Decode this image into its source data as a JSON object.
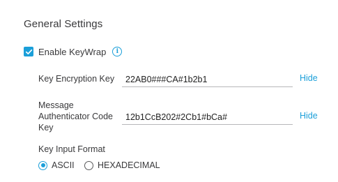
{
  "section": {
    "title": "General Settings"
  },
  "keywrap": {
    "label": "Enable KeyWrap",
    "checked": true,
    "info_icon": "info-icon"
  },
  "fields": {
    "key_encryption": {
      "label": "Key Encryption Key",
      "value": "22AB0###CA#1b2b1",
      "hide_label": "Hide"
    },
    "mac_key": {
      "label_line1": "Message",
      "label_line2": "Authenticator Code",
      "label_line3": "Key",
      "value": "12b1CcB202#2Cb1#bCa#",
      "hide_label": "Hide"
    }
  },
  "input_format": {
    "label": "Key Input Format",
    "options": [
      {
        "label": "ASCII",
        "selected": true
      },
      {
        "label": "HEXADECIMAL",
        "selected": false
      }
    ]
  },
  "colors": {
    "accent": "#1b9fd9",
    "text": "#39393b",
    "underline": "#b7b7b9"
  }
}
